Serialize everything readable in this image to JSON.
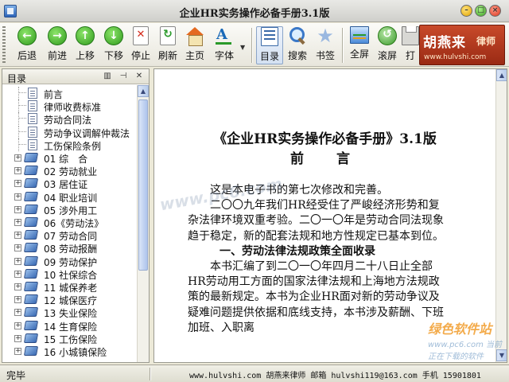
{
  "window": {
    "title": "企业HR实务操作必备手册3.1版"
  },
  "toolbar": {
    "buttons": [
      {
        "label": "后退",
        "icon": "back-arrow-icon"
      },
      {
        "label": "前进",
        "icon": "forward-arrow-icon"
      },
      {
        "label": "上移",
        "icon": "up-arrow-icon"
      },
      {
        "label": "下移",
        "icon": "down-arrow-icon"
      },
      {
        "label": "停止",
        "icon": "stop-icon"
      },
      {
        "label": "刷新",
        "icon": "refresh-icon"
      },
      {
        "label": "主页",
        "icon": "home-icon"
      },
      {
        "label": "字体",
        "icon": "font-icon"
      },
      {
        "label": "目录",
        "icon": "toc-icon"
      },
      {
        "label": "搜索",
        "icon": "search-icon"
      },
      {
        "label": "书签",
        "icon": "bookmark-star-icon"
      },
      {
        "label": "全屏",
        "icon": "fullscreen-icon"
      },
      {
        "label": "滚屏",
        "icon": "autoscroll-icon"
      },
      {
        "label": "打",
        "icon": "printer-icon"
      }
    ]
  },
  "brand": {
    "name": "胡燕来",
    "role": "律师",
    "url": "www.hulvshi.com"
  },
  "sidebar": {
    "title": "目录",
    "items": [
      {
        "label": "前言",
        "type": "page"
      },
      {
        "label": "律师收费标准",
        "type": "page"
      },
      {
        "label": "劳动合同法",
        "type": "page"
      },
      {
        "label": "劳动争议调解仲裁法",
        "type": "page"
      },
      {
        "label": "工伤保险条例",
        "type": "page"
      },
      {
        "label": "01 综　合",
        "type": "book"
      },
      {
        "label": "02 劳动就业",
        "type": "book"
      },
      {
        "label": "03 居住证",
        "type": "book"
      },
      {
        "label": "04 职业培训",
        "type": "book"
      },
      {
        "label": "05 涉外用工",
        "type": "book"
      },
      {
        "label": "06《劳动法》",
        "type": "book"
      },
      {
        "label": "07 劳动合同",
        "type": "book"
      },
      {
        "label": "08 劳动报酬",
        "type": "book"
      },
      {
        "label": "09 劳动保护",
        "type": "book"
      },
      {
        "label": "10 社保综合",
        "type": "book"
      },
      {
        "label": "11 城保养老",
        "type": "book"
      },
      {
        "label": "12 城保医疗",
        "type": "book"
      },
      {
        "label": "13 失业保险",
        "type": "book"
      },
      {
        "label": "14 生育保险",
        "type": "book"
      },
      {
        "label": "15 工伤保险",
        "type": "book"
      },
      {
        "label": "16 小城镇保险",
        "type": "book"
      }
    ]
  },
  "content": {
    "book_title": "《企业HR实务操作必备手册》3.1版",
    "preface_heading": "前　言",
    "paragraphs": [
      "这是本电子书的第七次修改和完善。",
      "二〇〇九年我们HR经受住了严峻经济形势和复杂法律环境双重考验。二〇一〇年是劳动合同法现象趋于稳定，新的配套法规和地方性规定已基本到位。"
    ],
    "section_heading": "一、劳动法律法规政策全面收录",
    "section_paragraph": "本书汇编了到二〇一〇年四月二十八日止全部HR劳动用工方面的国家法律法规和上海地方法规政策的最新规定。本书为企业HR面对新的劳动争议及疑难问题提供依据和底线支持，本书涉及薪酬、下班加班、入职离"
  },
  "watermarks": {
    "center": "www.pc6.com",
    "corner_title": "绿色软件站",
    "corner_sub": "www.pc6.com 当前正在下载的软件"
  },
  "statusbar": {
    "left": "完毕",
    "right": "www.hulvshi.com 胡燕来律师 邮箱 hulvshi119@163.com 手机 15901801"
  },
  "colors": {
    "titlebar": "#dcdcd8",
    "accent_blue": "#3a6ab4",
    "brand_red": "#b43a1e"
  }
}
